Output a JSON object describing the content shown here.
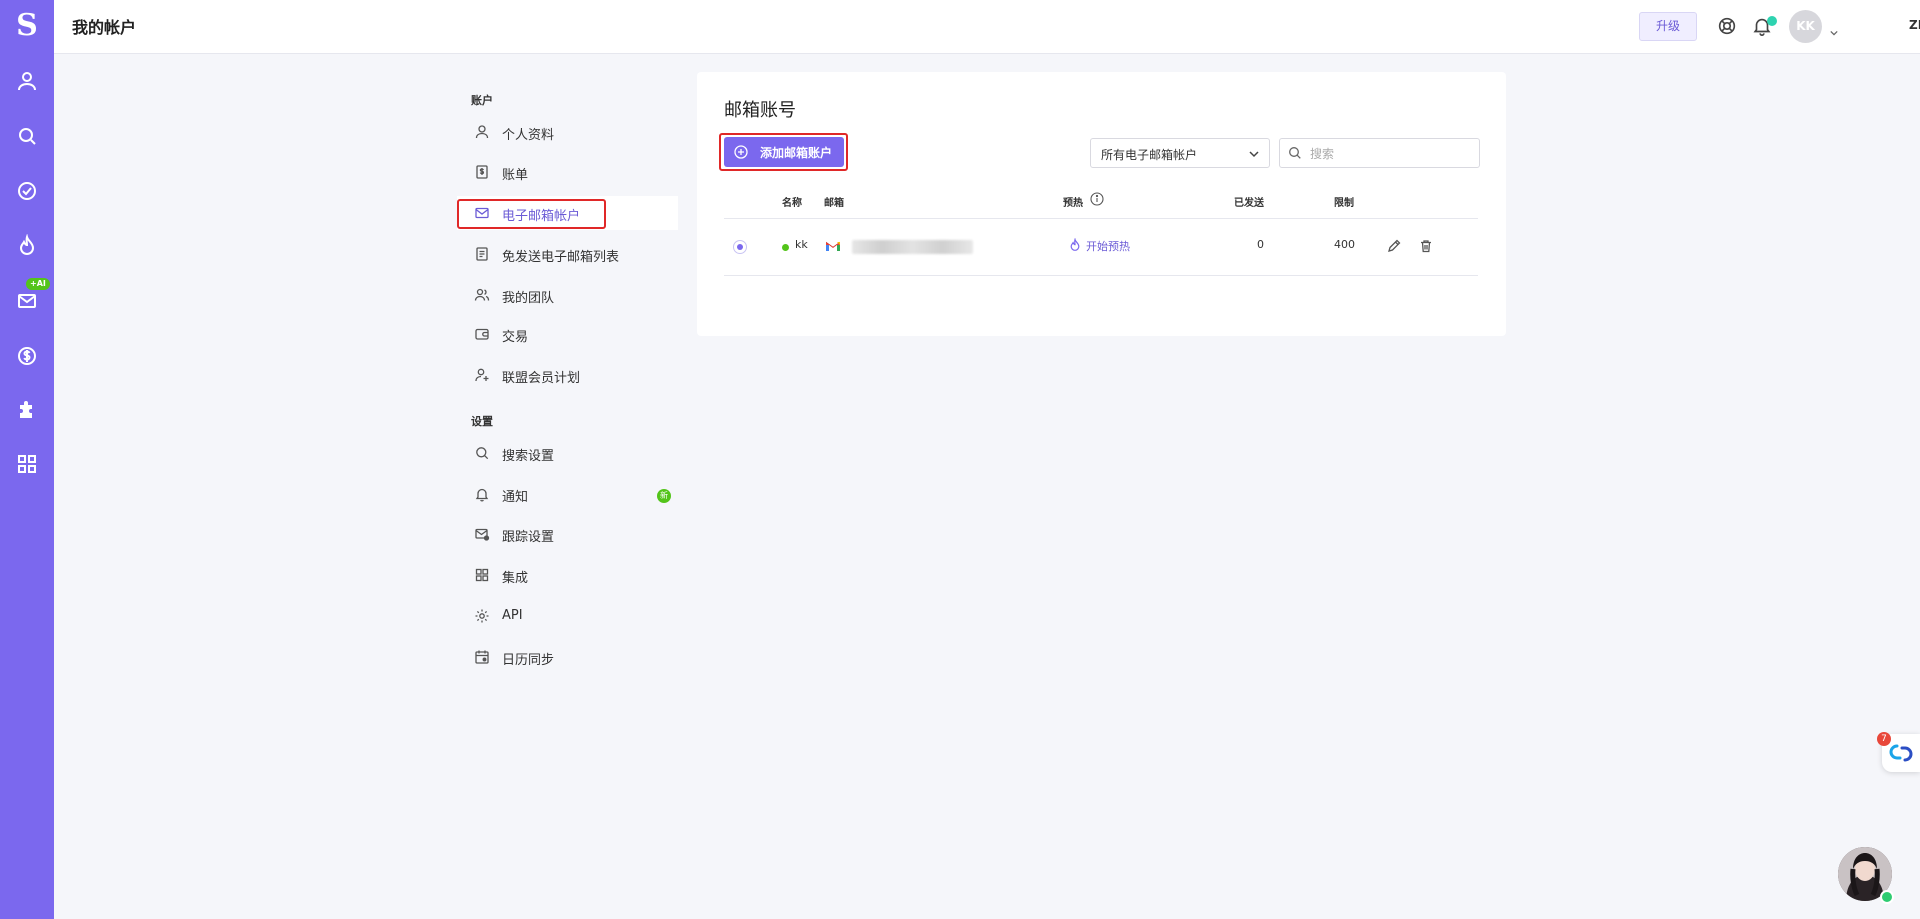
{
  "rail": {
    "logo": "S",
    "ai_badge": "+AI",
    "items": [
      "contacts",
      "search",
      "tasks",
      "warmup",
      "mail",
      "billing",
      "integrations",
      "apps"
    ]
  },
  "header": {
    "title": "我的帐户",
    "upgrade_label": "升级",
    "avatar_initials": "KK",
    "language": "ZH"
  },
  "settings_nav": {
    "account_section": "账户",
    "account_items": [
      {
        "label": "个人资料",
        "icon": "user-icon"
      },
      {
        "label": "账单",
        "icon": "invoice-icon"
      },
      {
        "label": "电子邮箱帐户",
        "icon": "mail-icon",
        "active": true
      },
      {
        "label": "免发送电子邮箱列表",
        "icon": "document-icon"
      },
      {
        "label": "我的团队",
        "icon": "team-icon"
      },
      {
        "label": "交易",
        "icon": "wallet-icon"
      },
      {
        "label": "联盟会员计划",
        "icon": "add-user-icon"
      }
    ],
    "settings_section": "设置",
    "settings_items": [
      {
        "label": "搜索设置",
        "icon": "search-icon"
      },
      {
        "label": "通知",
        "icon": "bell-icon",
        "badge": "新"
      },
      {
        "label": "跟踪设置",
        "icon": "mail-tracking-icon"
      },
      {
        "label": "集成",
        "icon": "apps-icon"
      },
      {
        "label": "API",
        "icon": "gear-icon"
      },
      {
        "label": "日历同步",
        "icon": "calendar-icon"
      }
    ]
  },
  "main": {
    "title": "邮箱账号",
    "add_button": "添加邮箱账户",
    "filter": {
      "selected": "所有电子邮箱帐户"
    },
    "search": {
      "placeholder": "搜索",
      "value": ""
    },
    "columns": {
      "name": "名称",
      "email": "邮箱",
      "warmup": "预热",
      "sent": "已发送",
      "limit": "限制"
    },
    "rows": [
      {
        "name": "kk",
        "email_provider": "gmail",
        "warmup_action": "开始预热",
        "sent": "0",
        "limit": "400"
      }
    ]
  },
  "widgets": {
    "help_badge": "7"
  },
  "colors": {
    "accent": "#7b68ee",
    "highlight": "#e02828",
    "success": "#53c41a"
  }
}
